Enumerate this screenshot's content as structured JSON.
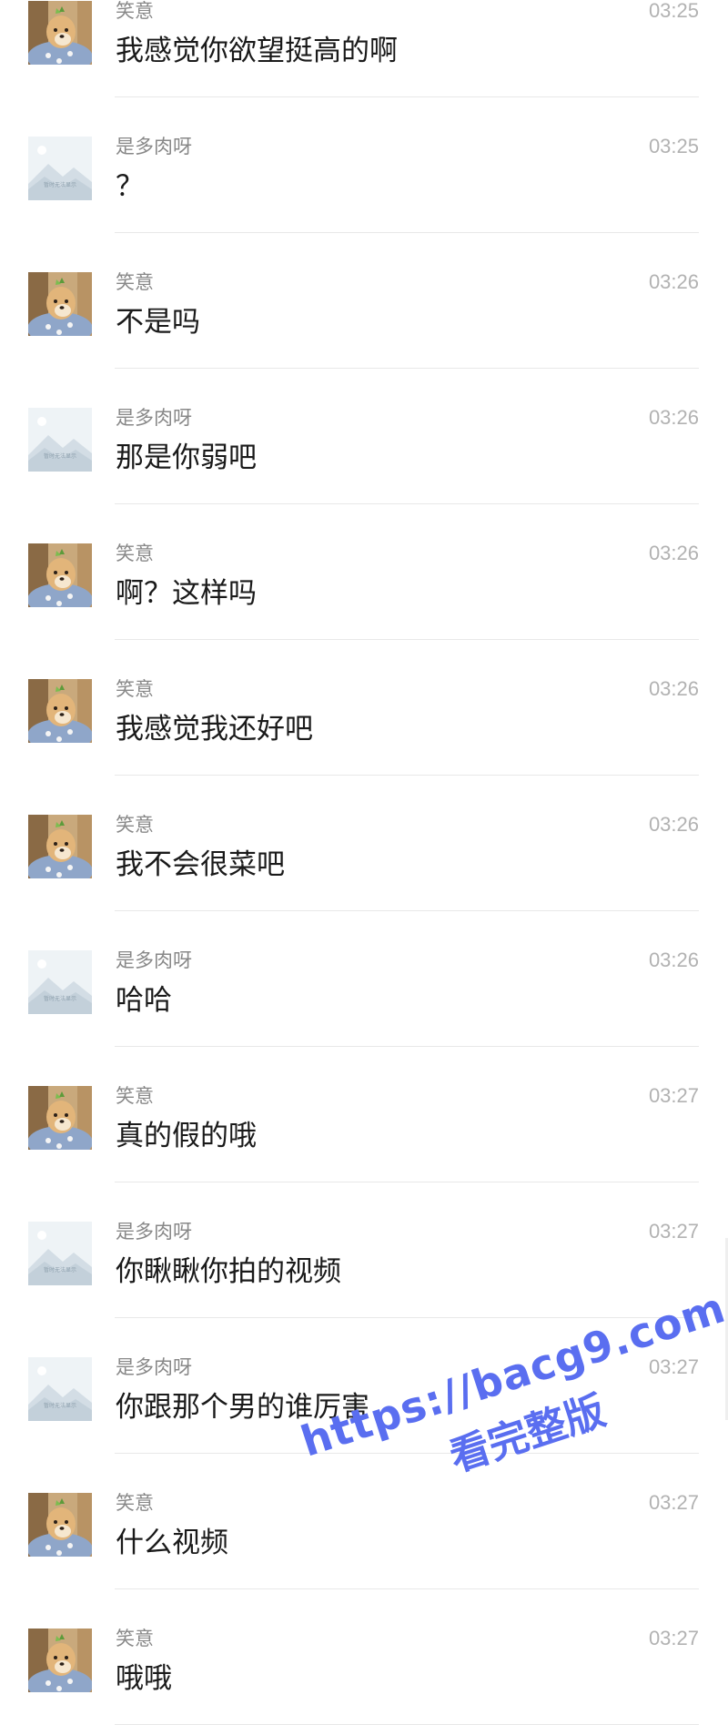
{
  "users": {
    "xiaoyi": {
      "name": "笑意",
      "avatar_icon": "shiba-dog-avatar-icon"
    },
    "duorou": {
      "name": "是多肉呀",
      "avatar_icon": "image-placeholder-icon",
      "placeholder_caption": "暂时无法显示"
    }
  },
  "messages": [
    {
      "sender": "xiaoyi",
      "name": "笑意",
      "time": "03:25",
      "text": "我感觉你欲望挺高的啊"
    },
    {
      "sender": "duorou",
      "name": "是多肉呀",
      "time": "03:25",
      "text": "？"
    },
    {
      "sender": "xiaoyi",
      "name": "笑意",
      "time": "03:26",
      "text": "不是吗"
    },
    {
      "sender": "duorou",
      "name": "是多肉呀",
      "time": "03:26",
      "text": "那是你弱吧"
    },
    {
      "sender": "xiaoyi",
      "name": "笑意",
      "time": "03:26",
      "text": "啊？这样吗"
    },
    {
      "sender": "xiaoyi",
      "name": "笑意",
      "time": "03:26",
      "text": "我感觉我还好吧"
    },
    {
      "sender": "xiaoyi",
      "name": "笑意",
      "time": "03:26",
      "text": "我不会很菜吧"
    },
    {
      "sender": "duorou",
      "name": "是多肉呀",
      "time": "03:26",
      "text": "哈哈"
    },
    {
      "sender": "xiaoyi",
      "name": "笑意",
      "time": "03:27",
      "text": "真的假的哦"
    },
    {
      "sender": "duorou",
      "name": "是多肉呀",
      "time": "03:27",
      "text": "你瞅瞅你拍的视频"
    },
    {
      "sender": "duorou",
      "name": "是多肉呀",
      "time": "03:27",
      "text": "你跟那个男的谁厉害"
    },
    {
      "sender": "xiaoyi",
      "name": "笑意",
      "time": "03:27",
      "text": "什么视频"
    },
    {
      "sender": "xiaoyi",
      "name": "笑意",
      "time": "03:27",
      "text": "哦哦"
    }
  ],
  "watermark": {
    "url": "https://bacg9.com",
    "subtitle": "看完整版",
    "color": "#5a6ef0"
  },
  "colors": {
    "name": "#888888",
    "time": "#b2b2b2",
    "text": "#1a1a1a",
    "divider": "#e8e8e8"
  }
}
